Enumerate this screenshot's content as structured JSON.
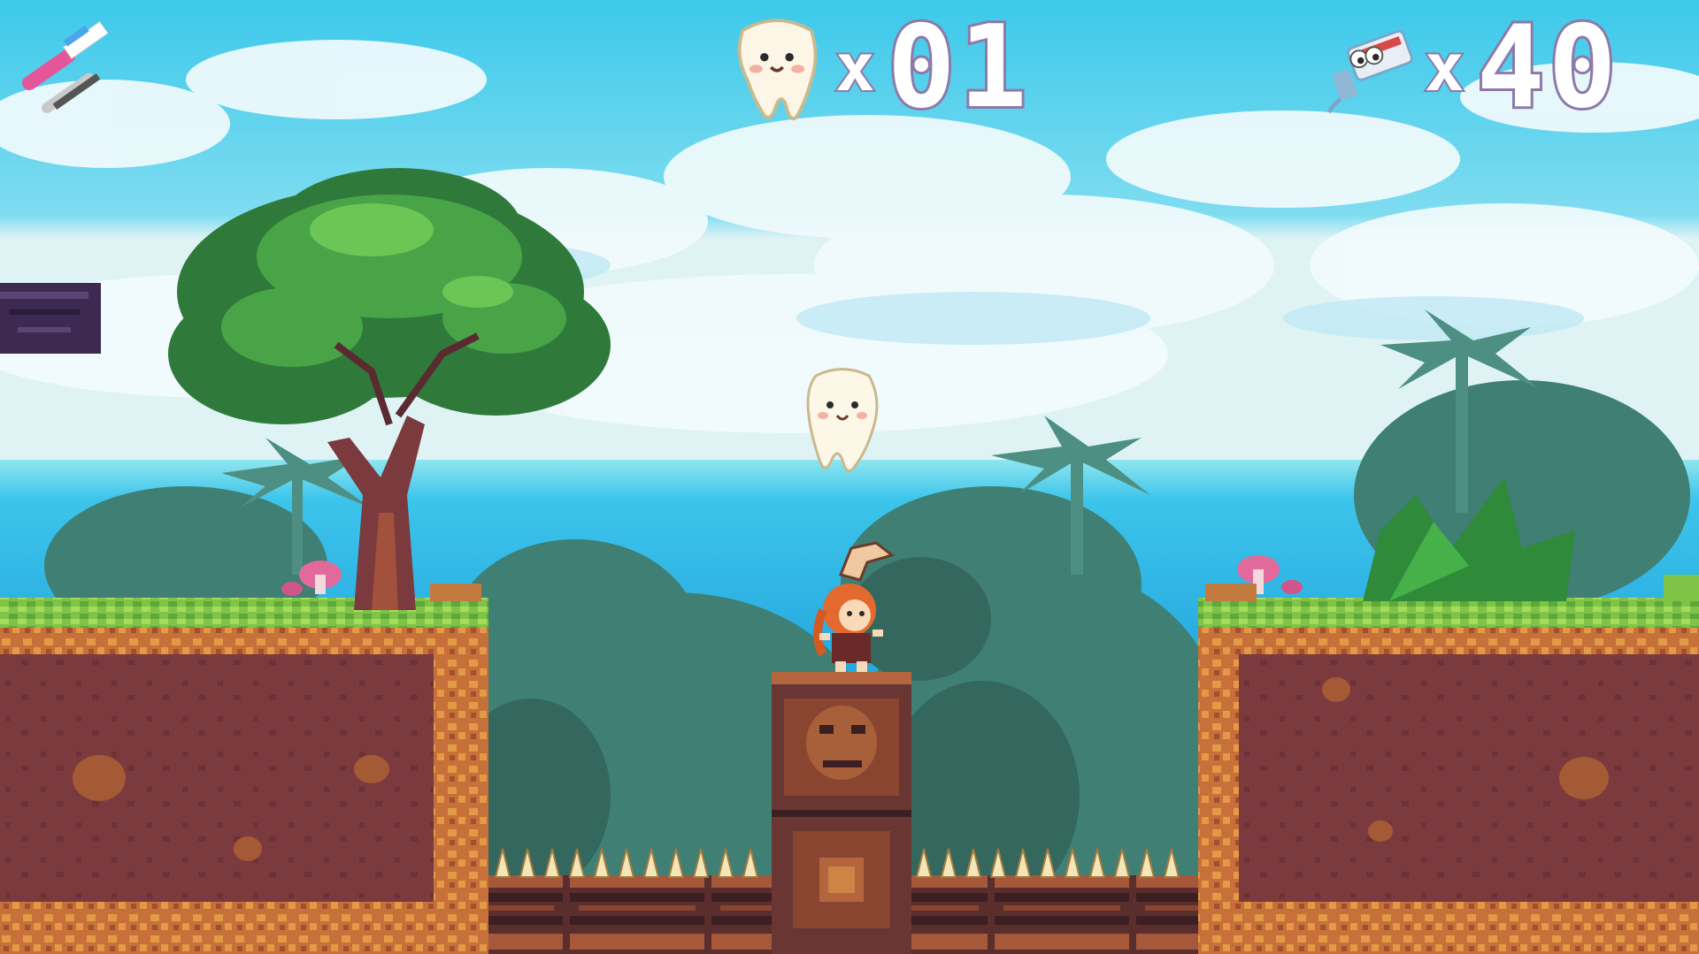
{
  "hud": {
    "weapon": {
      "icon": "toothbrush-icon",
      "selected_secondary": "cracked-tooth-icon"
    },
    "teeth": {
      "icon": "tooth-icon",
      "multiplier": "x",
      "count": "01"
    },
    "toothpaste": {
      "icon": "toothpaste-tube-icon",
      "multiplier": "x",
      "count": "40"
    }
  },
  "colors": {
    "sky": "#39c8e8",
    "ocean": "#2fb6e6",
    "grass": "#8fd14f",
    "dirt": "#7a3a3e",
    "dirt_edge": "#d48a3c",
    "hud_outline": "#8d7aa8"
  },
  "scene": {
    "player": "rabbit-eared-girl",
    "collectible": "floating-tooth",
    "hazard": "spike-row"
  }
}
